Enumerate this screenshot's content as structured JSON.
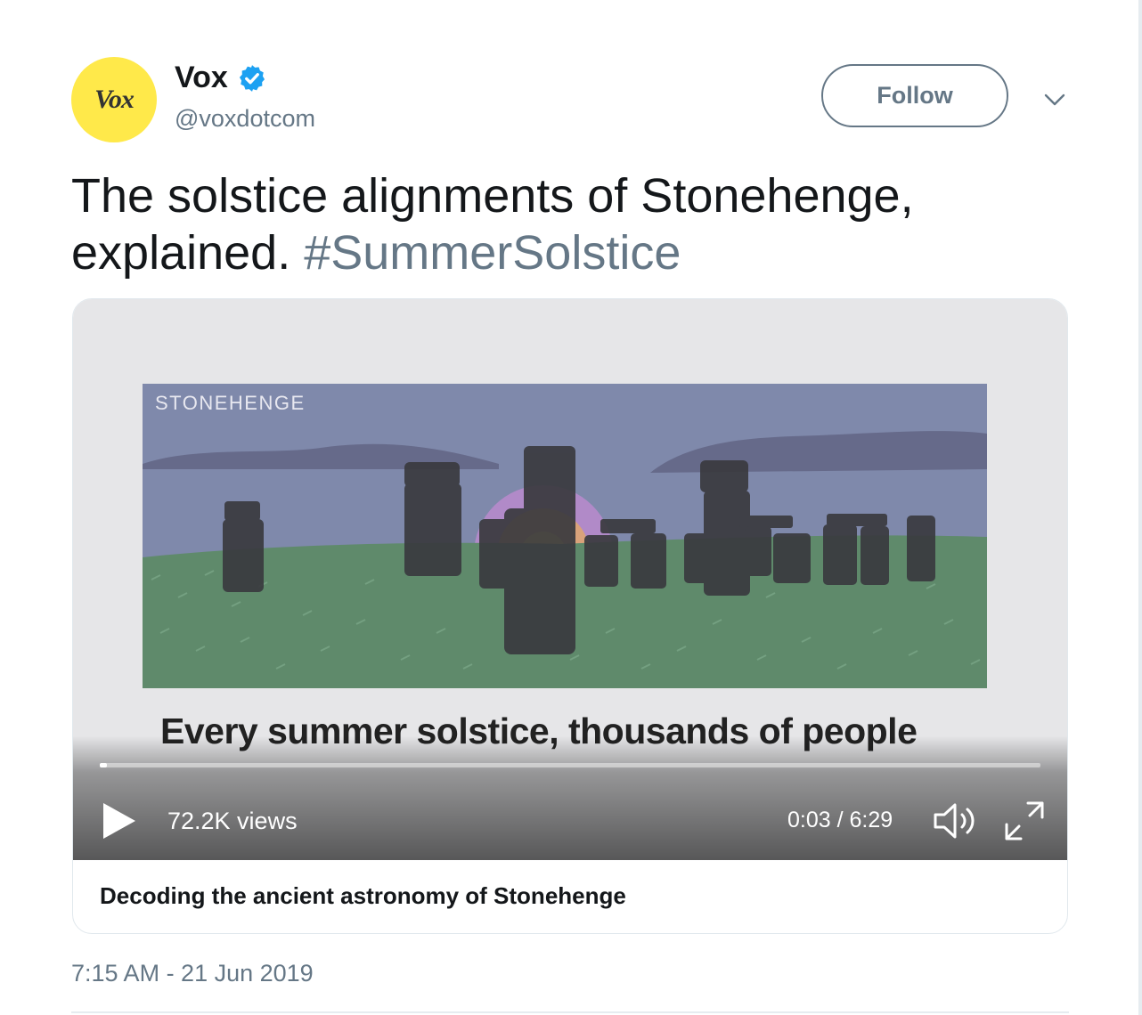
{
  "author": {
    "avatar_text": "Vox",
    "display_name": "Vox",
    "handle": "@voxdotcom",
    "verified": true
  },
  "actions": {
    "follow_label": "Follow",
    "menu_icon": "chevron-down-icon"
  },
  "tweet": {
    "text": "The solstice alignments of Stonehenge, explained.",
    "hashtag": "#SummerSolstice",
    "timestamp": "7:15 AM - 21 Jun 2019"
  },
  "video": {
    "scene_label": "STONEHENGE",
    "subtitle": "Every summer solstice, thousands of people",
    "views": "72.2K views",
    "time": "0:03 / 6:29",
    "progress": 0.008,
    "play_icon": "play-icon",
    "volume_icon": "volume-icon",
    "fullscreen_icon": "fullscreen-icon"
  },
  "card": {
    "title": "Decoding the ancient astronomy of Stonehenge"
  },
  "colors": {
    "avatar_bg": "#ffe94a",
    "verified": "#1da1f2",
    "secondary_text": "#657786",
    "sky": "#7f89ab",
    "grass": "#5f8a6b",
    "stone": "#3a3a3f"
  }
}
